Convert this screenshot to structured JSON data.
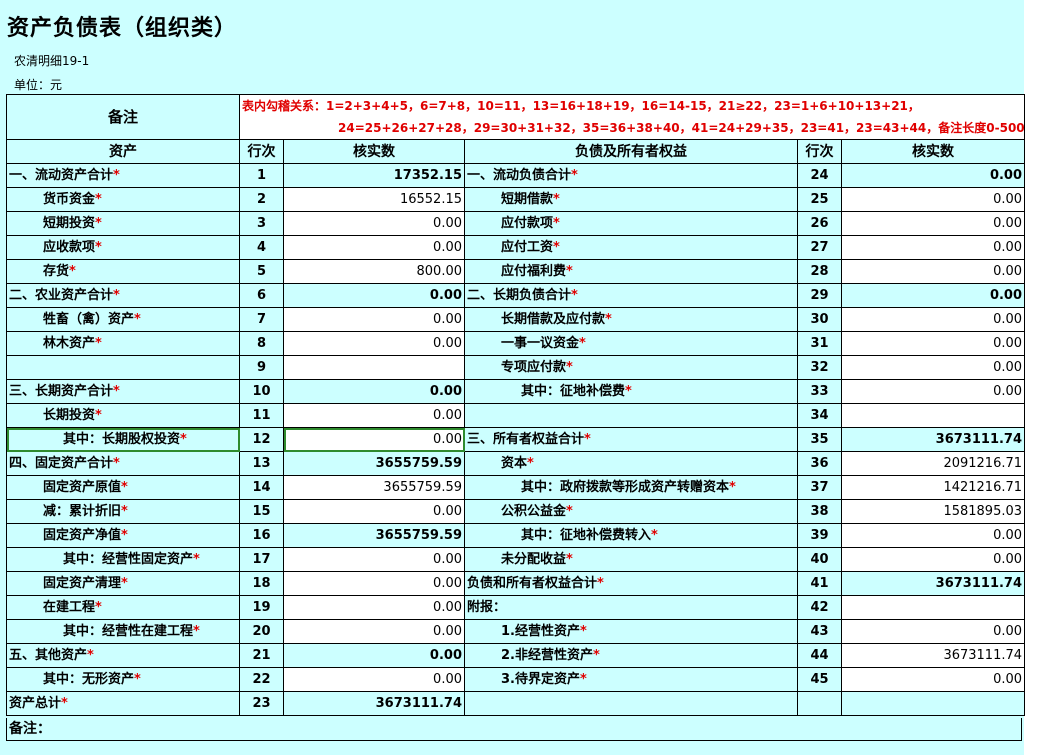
{
  "title": "资产负债表（组织类）",
  "code": "农清明细19-1",
  "unit": "单位：元",
  "remark_label": "备注",
  "relations_line1": "表内勾稽关系：1=2+3+4+5，6=7+8，10=11，13=16+18+19，16=14-15，21≥22，23=1+6+10+13+21，",
  "relations_line2": "24=25+26+27+28，29=30+31+32，35=36+38+40，41=24+29+35，23=41，23=43+44，备注长度0-500。",
  "headers": {
    "left_item": "资产",
    "left_line": "行次",
    "left_value": "核实数",
    "right_item": "负债及所有者权益",
    "right_line": "行次",
    "right_value": "核实数"
  },
  "star": "*",
  "rows": [
    {
      "l_label": "一、流动资产合计",
      "l_indent": 0,
      "l_star": true,
      "l_line": "1",
      "l_value": "17352.15",
      "l_bold": true,
      "r_label": "一、流动负债合计",
      "r_indent": 0,
      "r_star": true,
      "r_line": "24",
      "r_value": "0.00",
      "r_bold": true
    },
    {
      "l_label": "货币资金",
      "l_indent": 1,
      "l_star": true,
      "l_line": "2",
      "l_value": "16552.15",
      "l_bold": false,
      "r_label": "短期借款",
      "r_indent": 1,
      "r_star": true,
      "r_line": "25",
      "r_value": "0.00",
      "r_bold": false
    },
    {
      "l_label": "短期投资",
      "l_indent": 1,
      "l_star": true,
      "l_line": "3",
      "l_value": "0.00",
      "l_bold": false,
      "r_label": "应付款项",
      "r_indent": 1,
      "r_star": true,
      "r_line": "26",
      "r_value": "0.00",
      "r_bold": false
    },
    {
      "l_label": "应收款项",
      "l_indent": 1,
      "l_star": true,
      "l_line": "4",
      "l_value": "0.00",
      "l_bold": false,
      "r_label": "应付工资",
      "r_indent": 1,
      "r_star": true,
      "r_line": "27",
      "r_value": "0.00",
      "r_bold": false
    },
    {
      "l_label": "存货",
      "l_indent": 1,
      "l_star": true,
      "l_line": "5",
      "l_value": "800.00",
      "l_bold": false,
      "r_label": "应付福利费",
      "r_indent": 1,
      "r_star": true,
      "r_line": "28",
      "r_value": "0.00",
      "r_bold": false
    },
    {
      "l_label": "二、农业资产合计",
      "l_indent": 0,
      "l_star": true,
      "l_line": "6",
      "l_value": "0.00",
      "l_bold": true,
      "r_label": "二、长期负债合计",
      "r_indent": 0,
      "r_star": true,
      "r_line": "29",
      "r_value": "0.00",
      "r_bold": true
    },
    {
      "l_label": "牲畜（禽）资产",
      "l_indent": 1,
      "l_star": true,
      "l_line": "7",
      "l_value": "0.00",
      "l_bold": false,
      "r_label": "长期借款及应付款",
      "r_indent": 1,
      "r_star": true,
      "r_line": "30",
      "r_value": "0.00",
      "r_bold": false
    },
    {
      "l_label": "林木资产",
      "l_indent": 1,
      "l_star": true,
      "l_line": "8",
      "l_value": "0.00",
      "l_bold": false,
      "r_label": "一事一议资金",
      "r_indent": 1,
      "r_star": true,
      "r_line": "31",
      "r_value": "0.00",
      "r_bold": false
    },
    {
      "l_label": "",
      "l_indent": 0,
      "l_star": false,
      "l_line": "9",
      "l_value": "",
      "l_bold": false,
      "r_label": "专项应付款",
      "r_indent": 1,
      "r_star": true,
      "r_line": "32",
      "r_value": "0.00",
      "r_bold": false
    },
    {
      "l_label": "三、长期资产合计",
      "l_indent": 0,
      "l_star": true,
      "l_line": "10",
      "l_value": "0.00",
      "l_bold": true,
      "r_label": "其中：征地补偿费",
      "r_indent": 2,
      "r_star": true,
      "r_line": "33",
      "r_value": "0.00",
      "r_bold": false
    },
    {
      "l_label": "长期投资",
      "l_indent": 1,
      "l_star": true,
      "l_line": "11",
      "l_value": "0.00",
      "l_bold": false,
      "r_label": "",
      "r_indent": 0,
      "r_star": false,
      "r_line": "34",
      "r_value": "",
      "r_bold": false
    },
    {
      "l_label": "其中：长期股权投资",
      "l_indent": 2,
      "l_star": true,
      "l_line": "12",
      "l_value": "0.00",
      "l_bold": false,
      "selected": true,
      "r_label": "三、所有者权益合计",
      "r_indent": 0,
      "r_star": true,
      "r_line": "35",
      "r_value": "3673111.74",
      "r_bold": true
    },
    {
      "l_label": "四、固定资产合计",
      "l_indent": 0,
      "l_star": true,
      "l_line": "13",
      "l_value": "3655759.59",
      "l_bold": true,
      "r_label": "资本",
      "r_indent": 1,
      "r_star": true,
      "r_line": "36",
      "r_value": "2091216.71",
      "r_bold": false
    },
    {
      "l_label": "固定资产原值",
      "l_indent": 1,
      "l_star": true,
      "l_line": "14",
      "l_value": "3655759.59",
      "l_bold": false,
      "r_label": "其中：政府拨款等形成资产转赠资本",
      "r_indent": 2,
      "r_star": true,
      "r_line": "37",
      "r_value": "1421216.71",
      "r_bold": false
    },
    {
      "l_label": "减：累计折旧",
      "l_indent": 3,
      "l_star": true,
      "l_line": "15",
      "l_value": "0.00",
      "l_bold": false,
      "r_label": "公积公益金",
      "r_indent": 1,
      "r_star": true,
      "r_line": "38",
      "r_value": "1581895.03",
      "r_bold": false
    },
    {
      "l_label": "固定资产净值",
      "l_indent": 1,
      "l_star": true,
      "l_line": "16",
      "l_value": "3655759.59",
      "l_bold": true,
      "r_label": "其中：征地补偿费转入",
      "r_indent": 2,
      "r_star": true,
      "r_line": "39",
      "r_value": "0.00",
      "r_bold": false
    },
    {
      "l_label": "其中：经营性固定资产",
      "l_indent": 2,
      "l_star": true,
      "l_line": "17",
      "l_value": "0.00",
      "l_bold": false,
      "r_label": "未分配收益",
      "r_indent": 1,
      "r_star": true,
      "r_line": "40",
      "r_value": "0.00",
      "r_bold": false
    },
    {
      "l_label": "固定资产清理",
      "l_indent": 1,
      "l_star": true,
      "l_line": "18",
      "l_value": "0.00",
      "l_bold": false,
      "r_label": "负债和所有者权益合计",
      "r_indent": 0,
      "r_star": true,
      "r_line": "41",
      "r_value": "3673111.74",
      "r_bold": true
    },
    {
      "l_label": "在建工程",
      "l_indent": 1,
      "l_star": true,
      "l_line": "19",
      "l_value": "0.00",
      "l_bold": false,
      "r_label": "附报：",
      "r_indent": 0,
      "r_star": false,
      "r_line": "42",
      "r_value": "",
      "r_bold": false
    },
    {
      "l_label": "其中：经营性在建工程",
      "l_indent": 2,
      "l_star": true,
      "l_line": "20",
      "l_value": "0.00",
      "l_bold": false,
      "r_label": "1.经营性资产",
      "r_indent": 1,
      "r_star": true,
      "r_line": "43",
      "r_value": "0.00",
      "r_bold": false
    },
    {
      "l_label": "五、其他资产",
      "l_indent": 0,
      "l_star": true,
      "l_line": "21",
      "l_value": "0.00",
      "l_bold": true,
      "r_label": "2.非经营性资产",
      "r_indent": 1,
      "r_star": true,
      "r_line": "44",
      "r_value": "3673111.74",
      "r_bold": false
    },
    {
      "l_label": "其中：无形资产",
      "l_indent": 1,
      "l_star": true,
      "l_line": "22",
      "l_value": "0.00",
      "l_bold": false,
      "r_label": "3.待界定资产",
      "r_indent": 1,
      "r_star": true,
      "r_line": "45",
      "r_value": "0.00",
      "r_bold": false
    },
    {
      "l_label": "资产总计",
      "l_indent": 0,
      "l_star": true,
      "l_line": "23",
      "l_value": "3673111.74",
      "l_bold": true,
      "r_label": "",
      "r_indent": 0,
      "r_star": false,
      "r_line": "",
      "r_value": "",
      "r_bold": false
    }
  ],
  "footer_remark": "备注："
}
